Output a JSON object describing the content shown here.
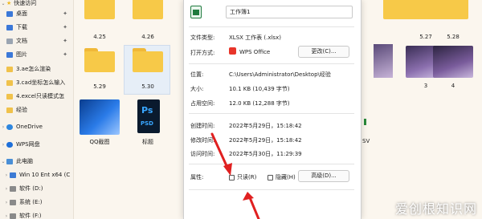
{
  "sidebar": {
    "quick_access": "快速访问",
    "items": [
      {
        "label": "桌面",
        "icon": "desktop-icon",
        "pinned": true
      },
      {
        "label": "下载",
        "icon": "download-icon",
        "pinned": true
      },
      {
        "label": "文档",
        "icon": "documents-icon",
        "pinned": true
      },
      {
        "label": "图片",
        "icon": "pictures-icon",
        "pinned": true
      },
      {
        "label": "3.ae怎么渲染",
        "icon": "folder-icon",
        "pinned": false
      },
      {
        "label": "3.cad坐标怎么输入",
        "icon": "folder-icon",
        "pinned": false
      },
      {
        "label": "4.excel只读模式怎",
        "icon": "folder-icon",
        "pinned": false
      },
      {
        "label": "经验",
        "icon": "folder-icon",
        "pinned": false
      }
    ],
    "onedrive": "OneDrive",
    "wps_cloud": "WPS网盘",
    "this_pc": "此电脑",
    "drives": [
      "Win 10 Ent x64 (C",
      "软件 (D:)",
      "系统 (E:)",
      "软件 (F:)"
    ]
  },
  "files": {
    "items": [
      "4.25",
      "4.26",
      "5.29",
      "5.30",
      "QQ截图",
      "标题",
      "5.27",
      "5.28",
      "3",
      "4"
    ],
    "partial_label": "SV",
    "psd_label": "PSD",
    "ps_label": "Ps"
  },
  "dialog": {
    "filename": "工作簿1",
    "rows": [
      {
        "label": "文件类型:",
        "value": "XLSX 工作表 (.xlsx)"
      },
      {
        "label": "打开方式:",
        "value": "WPS Office"
      },
      {
        "label": "位置:",
        "value": "C:\\Users\\Administrator\\Desktop\\经验"
      },
      {
        "label": "大小:",
        "value": "10.1 KB (10,439 字节)"
      },
      {
        "label": "占用空间:",
        "value": "12.0 KB (12,288 字节)"
      },
      {
        "label": "创建时间:",
        "value": "2022年5月29日，15:18:42"
      },
      {
        "label": "修改时间:",
        "value": "2022年5月29日，15:18:42"
      },
      {
        "label": "访问时间:",
        "value": "2022年5月30日，11:29:39"
      }
    ],
    "change_button": "更改(C)...",
    "attributes_label": "属性:",
    "readonly_label": "只读(R)",
    "hidden_label": "隐藏(H)",
    "advanced_button": "高级(D)..."
  },
  "watermark": "爱创根知识网",
  "colors": {
    "folder": "#f7c948",
    "arrow": "#e02020",
    "selection": "#e6eef7"
  }
}
